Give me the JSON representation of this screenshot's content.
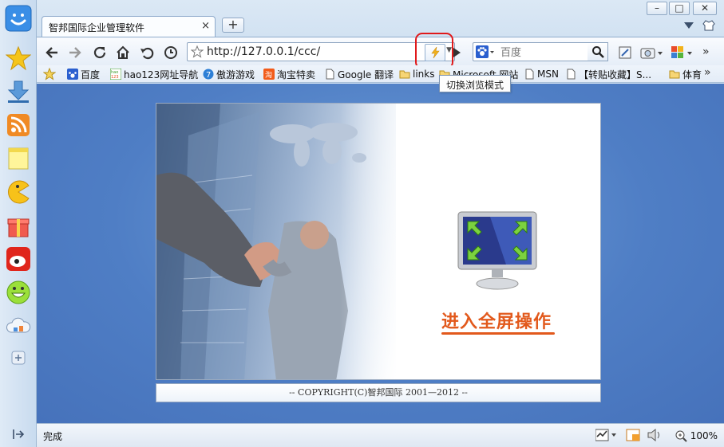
{
  "window": {
    "tab_title": "智邦国际企业管理软件",
    "tab_close": "×",
    "new_tab": "+",
    "controls": {
      "minimize": "–",
      "maximize": "□",
      "close": "✕"
    }
  },
  "toolbar": {
    "url": "http://127.0.0.1/ccc/",
    "search_placeholder": "百度",
    "mode_tooltip": "切换浏览模式"
  },
  "bookmarks": [
    {
      "label": "百度",
      "icon": "baidu-paw-icon"
    },
    {
      "label": "hao123网址导航",
      "icon": "hao123-icon"
    },
    {
      "label": "傲游游戏",
      "icon": "maxthon-game-icon"
    },
    {
      "label": "淘宝特卖",
      "icon": "taobao-icon"
    },
    {
      "label": "Google 翻译",
      "icon": "page-icon"
    },
    {
      "label": "links",
      "icon": "folder-icon"
    },
    {
      "label": "Microsoft 网站",
      "icon": "folder-icon"
    },
    {
      "label": "MSN",
      "icon": "page-icon"
    },
    {
      "label": "【转贴收藏】S...",
      "icon": "page-icon"
    },
    {
      "label": "体育",
      "icon": "folder-icon"
    }
  ],
  "more_chevron": "»",
  "page": {
    "enter_label": "进入全屏操作",
    "copyright": "-- COPYRIGHT(C)智邦国际 2001—2012 --"
  },
  "status": {
    "text": "完成",
    "zoom": "100%"
  }
}
